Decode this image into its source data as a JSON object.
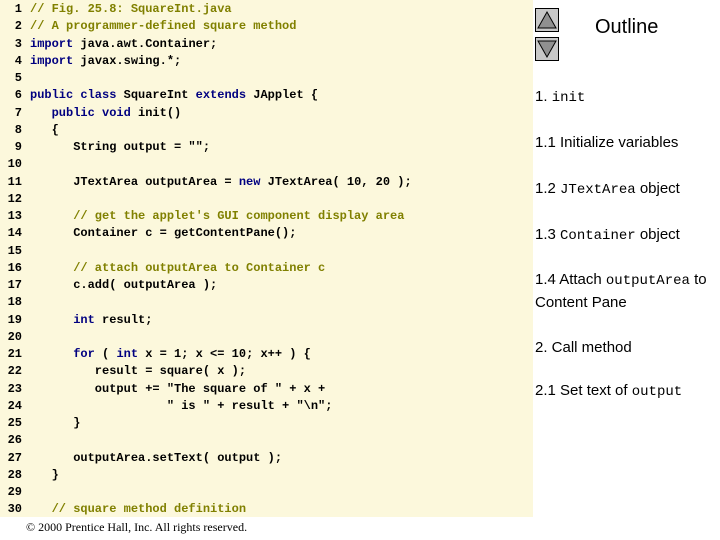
{
  "code_lines": [
    {
      "num": "1",
      "segs": [
        {
          "t": "// Fig. 25.8: SquareInt.java",
          "c": "cm"
        }
      ]
    },
    {
      "num": "2",
      "segs": [
        {
          "t": "// A programmer-defined square method",
          "c": "cm"
        }
      ]
    },
    {
      "num": "3",
      "segs": [
        {
          "t": "import",
          "c": "kw"
        },
        {
          "t": " java.awt.Container;",
          "c": "nm"
        }
      ]
    },
    {
      "num": "4",
      "segs": [
        {
          "t": "import",
          "c": "kw"
        },
        {
          "t": " javax.swing.*;",
          "c": "nm"
        }
      ]
    },
    {
      "num": "5",
      "segs": []
    },
    {
      "num": "6",
      "segs": [
        {
          "t": "public class",
          "c": "kw"
        },
        {
          "t": " SquareInt ",
          "c": "nm"
        },
        {
          "t": "extends",
          "c": "kw"
        },
        {
          "t": " JApplet {",
          "c": "nm"
        }
      ]
    },
    {
      "num": "7",
      "segs": [
        {
          "t": "   ",
          "c": "nm"
        },
        {
          "t": "public void",
          "c": "kw"
        },
        {
          "t": " init()",
          "c": "nm"
        }
      ]
    },
    {
      "num": "8",
      "segs": [
        {
          "t": "   {",
          "c": "nm"
        }
      ]
    },
    {
      "num": "9",
      "segs": [
        {
          "t": "      String output = \"\";",
          "c": "nm"
        }
      ]
    },
    {
      "num": "10",
      "segs": []
    },
    {
      "num": "11",
      "segs": [
        {
          "t": "      JTextArea outputArea = ",
          "c": "nm"
        },
        {
          "t": "new",
          "c": "kw"
        },
        {
          "t": " JTextArea( 10, 20 );",
          "c": "nm"
        }
      ]
    },
    {
      "num": "12",
      "segs": []
    },
    {
      "num": "13",
      "segs": [
        {
          "t": "      // get the applet's GUI component display area",
          "c": "cm"
        }
      ]
    },
    {
      "num": "14",
      "segs": [
        {
          "t": "      Container c = getContentPane();",
          "c": "nm"
        }
      ]
    },
    {
      "num": "15",
      "segs": []
    },
    {
      "num": "16",
      "segs": [
        {
          "t": "      // attach outputArea to Container c",
          "c": "cm"
        }
      ]
    },
    {
      "num": "17",
      "segs": [
        {
          "t": "      c.add( outputArea );",
          "c": "nm"
        }
      ]
    },
    {
      "num": "18",
      "segs": []
    },
    {
      "num": "19",
      "segs": [
        {
          "t": "      ",
          "c": "nm"
        },
        {
          "t": "int",
          "c": "kw"
        },
        {
          "t": " result;",
          "c": "nm"
        }
      ]
    },
    {
      "num": "20",
      "segs": []
    },
    {
      "num": "21",
      "segs": [
        {
          "t": "      ",
          "c": "nm"
        },
        {
          "t": "for",
          "c": "kw"
        },
        {
          "t": " ( ",
          "c": "nm"
        },
        {
          "t": "int",
          "c": "kw"
        },
        {
          "t": " x = 1; x <= 10; x++ ) {",
          "c": "nm"
        }
      ]
    },
    {
      "num": "22",
      "segs": [
        {
          "t": "         result = square( x );",
          "c": "nm"
        }
      ]
    },
    {
      "num": "23",
      "segs": [
        {
          "t": "         output += \"The square of \" + x +",
          "c": "nm"
        }
      ]
    },
    {
      "num": "24",
      "segs": [
        {
          "t": "                   \" is \" + result + \"\\n\";",
          "c": "nm"
        }
      ]
    },
    {
      "num": "25",
      "segs": [
        {
          "t": "      }",
          "c": "nm"
        }
      ]
    },
    {
      "num": "26",
      "segs": []
    },
    {
      "num": "27",
      "segs": [
        {
          "t": "      outputArea.setText( output );",
          "c": "nm"
        }
      ]
    },
    {
      "num": "28",
      "segs": [
        {
          "t": "   }",
          "c": "nm"
        }
      ]
    },
    {
      "num": "29",
      "segs": []
    },
    {
      "num": "30",
      "segs": [
        {
          "t": "   // square method definition",
          "c": "cm"
        }
      ]
    }
  ],
  "copyright": "© 2000 Prentice Hall, Inc.  All rights reserved.",
  "outline": {
    "title": "Outline",
    "items": [
      {
        "segs": [
          {
            "t": "1. ",
            "m": false
          },
          {
            "t": "init",
            "m": true
          }
        ]
      },
      {
        "segs": [
          {
            "t": "1.1 Initialize variables",
            "m": false
          }
        ]
      },
      {
        "segs": [
          {
            "t": "1.2 ",
            "m": false
          },
          {
            "t": "JTextArea",
            "m": true
          },
          {
            "t": " object",
            "m": false
          }
        ]
      },
      {
        "segs": [
          {
            "t": "1.3 ",
            "m": false
          },
          {
            "t": "Container",
            "m": true
          },
          {
            "t": " object",
            "m": false
          }
        ]
      },
      {
        "segs": [
          {
            "t": "1.4 Attach ",
            "m": false
          },
          {
            "t": "outputArea",
            "m": true
          },
          {
            "t": " to Content Pane",
            "m": false
          }
        ]
      },
      {
        "segs": [
          {
            "t": "2. Call method",
            "m": false
          }
        ]
      },
      {
        "segs": [
          {
            "t": "2.1 Set text of ",
            "m": false
          },
          {
            "t": "output",
            "m": true
          }
        ]
      }
    ]
  },
  "nav": {
    "up_icon": "triangle-up-icon",
    "down_icon": "triangle-down-icon"
  },
  "colors": {
    "panel_bg": "#fcf8dc",
    "keyword": "#000080",
    "comment": "#808000",
    "button_bg": "#c8c8c8"
  }
}
